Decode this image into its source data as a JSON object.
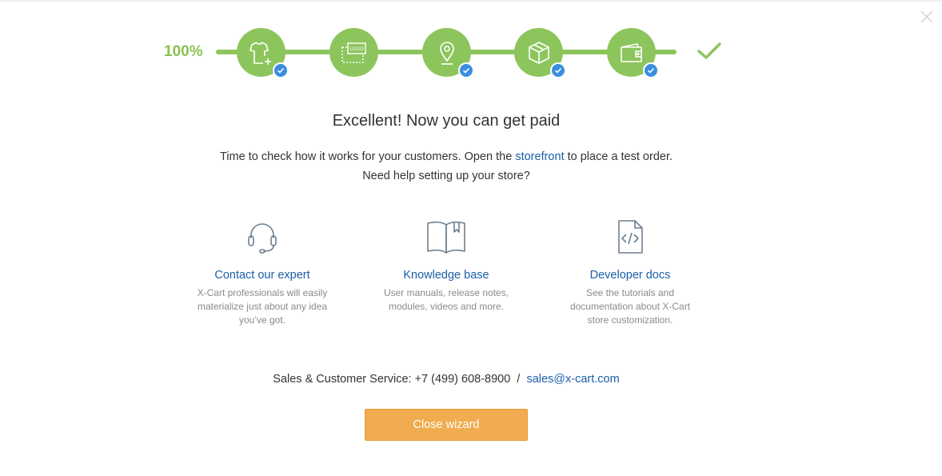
{
  "progress": {
    "percent_label": "100%",
    "value": 1.0,
    "steps": [
      {
        "name": "add-product",
        "icon": "tshirt-plus-icon",
        "done": true
      },
      {
        "name": "logo",
        "icon": "logo-icon",
        "logo_text": "LOGO",
        "done": true
      },
      {
        "name": "location",
        "icon": "map-pin-icon",
        "done": true
      },
      {
        "name": "shipping",
        "icon": "box-icon",
        "done": true
      },
      {
        "name": "payment",
        "icon": "wallet-icon",
        "done": true
      }
    ],
    "accent_color": "#8dc55d",
    "badge_color": "#3a8ee0"
  },
  "headline": "Excellent! Now you can get paid",
  "subtitle": {
    "before_link": "Time to check how it works for your customers. Open the",
    "link": "storefront",
    "after_link": "to place a test order.",
    "line2": "Need help setting up your store?"
  },
  "resources": [
    {
      "title": "Contact our expert",
      "description": "X-Cart professionals will easily materialize just about any idea you’ve got.",
      "icon": "headset-icon"
    },
    {
      "title": "Knowledge base",
      "description": "User manuals, release notes, modules, videos and more.",
      "icon": "book-icon"
    },
    {
      "title": "Developer docs",
      "description": "See the tutorials and documentation about X-Cart store customization.",
      "icon": "code-document-icon"
    }
  ],
  "contact": {
    "label": "Sales & Customer Service: +7 (499) 608-8900",
    "separator": "/",
    "email": "sales@x-cart.com"
  },
  "close_button": "Close wizard",
  "link_color": "#1c5ea8",
  "button_color": "#f0ac4e"
}
